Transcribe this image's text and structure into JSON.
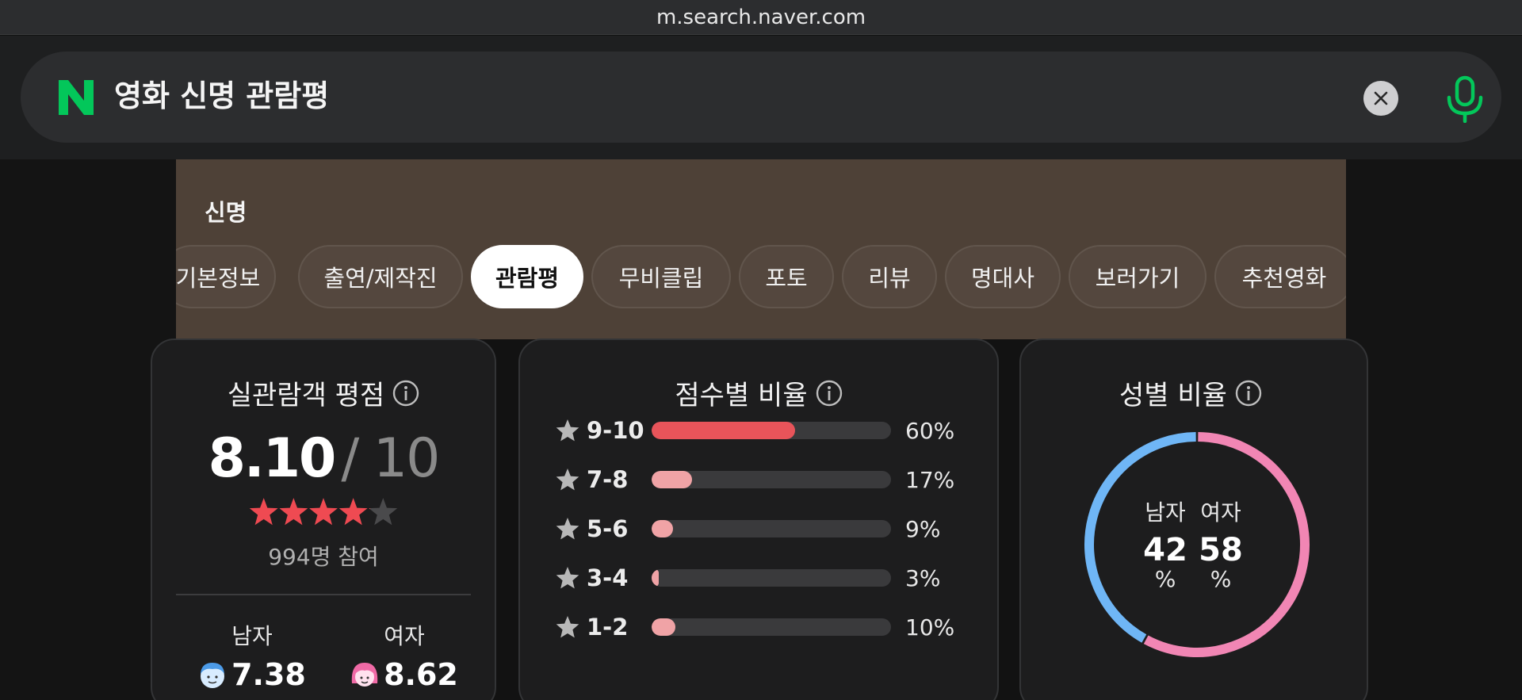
{
  "browser": {
    "url": "m.search.naver.com"
  },
  "search": {
    "logo": "N",
    "query": "영화 신명 관람평",
    "clear_icon": "close-icon",
    "mic_icon": "microphone-icon"
  },
  "movie": {
    "title": "신명",
    "tabs": [
      {
        "label": "기본정보",
        "active": false
      },
      {
        "label": "출연/제작진",
        "active": false
      },
      {
        "label": "관람평",
        "active": true
      },
      {
        "label": "무비클립",
        "active": false
      },
      {
        "label": "포토",
        "active": false
      },
      {
        "label": "리뷰",
        "active": false
      },
      {
        "label": "명대사",
        "active": false
      },
      {
        "label": "보러가기",
        "active": false
      },
      {
        "label": "추천영화",
        "active": false
      }
    ]
  },
  "rating_card": {
    "title": "실관람객 평점",
    "score": "8.10",
    "max": "/ 10",
    "stars_value": 4.05,
    "stars_max": 5,
    "participants": "994명 참여",
    "male": {
      "label": "남자",
      "score": "7.38"
    },
    "female": {
      "label": "여자",
      "score": "8.62"
    }
  },
  "distribution_card": {
    "title": "점수별 비율",
    "rows": [
      {
        "label": "9-10",
        "pct_text": "60%",
        "value": 60,
        "color": "#e8545a"
      },
      {
        "label": "7-8",
        "pct_text": "17%",
        "value": 17,
        "color": "#f0a3a6"
      },
      {
        "label": "5-6",
        "pct_text": "9%",
        "value": 9,
        "color": "#f0a3a6"
      },
      {
        "label": "3-4",
        "pct_text": "3%",
        "value": 3,
        "color": "#f0a3a6"
      },
      {
        "label": "1-2",
        "pct_text": "10%",
        "value": 10,
        "color": "#f0a3a6"
      }
    ]
  },
  "gender_card": {
    "title": "성별 비율",
    "male": {
      "label": "남자",
      "value": "42",
      "unit": "%",
      "pct": 42,
      "color": "#6fb6f6"
    },
    "female": {
      "label": "여자",
      "value": "58",
      "unit": "%",
      "pct": 58,
      "color": "#f186b4"
    }
  },
  "colors": {
    "naver_green": "#03c75a",
    "star_red": "#ef4a52",
    "hero_brown": "#4e4137"
  }
}
